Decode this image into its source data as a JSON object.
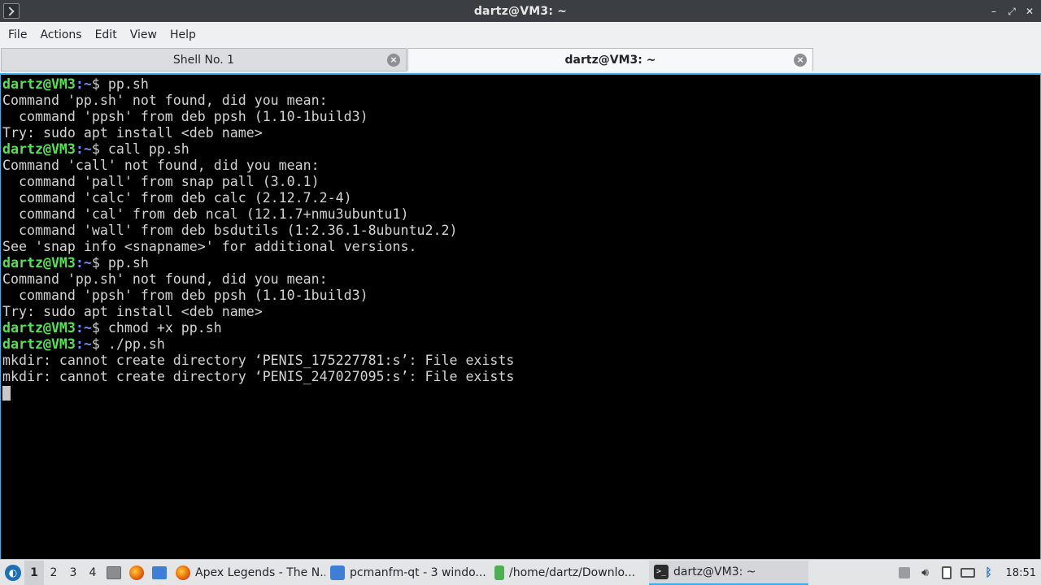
{
  "window": {
    "title": "dartz@VM3: ~",
    "controls": {
      "minimize": "–",
      "maximize": "⤢",
      "close": "✕"
    }
  },
  "menu": [
    "File",
    "Actions",
    "Edit",
    "View",
    "Help"
  ],
  "tabs": [
    {
      "label": "Shell No. 1",
      "active": false
    },
    {
      "label": "dartz@VM3: ~",
      "active": true
    }
  ],
  "terminal": {
    "prompt_user": "dartz@VM3",
    "prompt_path": ":~",
    "prompt_symbol": "$ ",
    "lines": [
      {
        "prompt": true,
        "text": "pp.sh"
      },
      {
        "prompt": false,
        "text": "Command 'pp.sh' not found, did you mean:"
      },
      {
        "prompt": false,
        "text": "  command 'ppsh' from deb ppsh (1.10-1build3)"
      },
      {
        "prompt": false,
        "text": "Try: sudo apt install <deb name>"
      },
      {
        "prompt": true,
        "text": "call pp.sh"
      },
      {
        "prompt": false,
        "text": "Command 'call' not found, did you mean:"
      },
      {
        "prompt": false,
        "text": "  command 'pall' from snap pall (3.0.1)"
      },
      {
        "prompt": false,
        "text": "  command 'calc' from deb calc (2.12.7.2-4)"
      },
      {
        "prompt": false,
        "text": "  command 'cal' from deb ncal (12.1.7+nmu3ubuntu1)"
      },
      {
        "prompt": false,
        "text": "  command 'wall' from deb bsdutils (1:2.36.1-8ubuntu2.2)"
      },
      {
        "prompt": false,
        "text": "See 'snap info <snapname>' for additional versions."
      },
      {
        "prompt": true,
        "text": "pp.sh"
      },
      {
        "prompt": false,
        "text": "Command 'pp.sh' not found, did you mean:"
      },
      {
        "prompt": false,
        "text": "  command 'ppsh' from deb ppsh (1.10-1build3)"
      },
      {
        "prompt": false,
        "text": "Try: sudo apt install <deb name>"
      },
      {
        "prompt": true,
        "text": "chmod +x pp.sh"
      },
      {
        "prompt": true,
        "text": "./pp.sh"
      },
      {
        "prompt": false,
        "text": "mkdir: cannot create directory ‘PENIS_175227781:s’: File exists"
      },
      {
        "prompt": false,
        "text": "mkdir: cannot create directory ‘PENIS_247027095:s’: File exists"
      }
    ]
  },
  "taskbar": {
    "start_icon": "lubuntu-logo-icon",
    "desktops": [
      "1",
      "2",
      "3",
      "4"
    ],
    "current_desktop": "1",
    "quick_launch": [
      "file-manager-icon",
      "firefox-icon",
      "desktop-icon"
    ],
    "tasks": [
      {
        "label": "Apex Legends - The N...",
        "icon": "firefox-icon",
        "color": "#e66000"
      },
      {
        "label": "pcmanfm-qt - 3 windo...",
        "icon": "folder-icon",
        "color": "#3d7fd6"
      },
      {
        "label": "/home/dartz/Downlo...",
        "icon": "archive-icon",
        "color": "#4caf50"
      },
      {
        "label": "dartz@VM3: ~",
        "icon": "terminal-icon",
        "color": "#2b2b2b"
      }
    ],
    "tray_icons": [
      "updates-icon",
      "volume-icon",
      "clipboard-icon",
      "keyboard-icon",
      "bluetooth-icon"
    ],
    "clock": "18:51"
  },
  "colors": {
    "accent": "#3daee9",
    "prompt_user": "#54e354",
    "prompt_path": "#6e8bff",
    "terminal_bg": "#000000",
    "terminal_fg": "#d3d3d3"
  }
}
